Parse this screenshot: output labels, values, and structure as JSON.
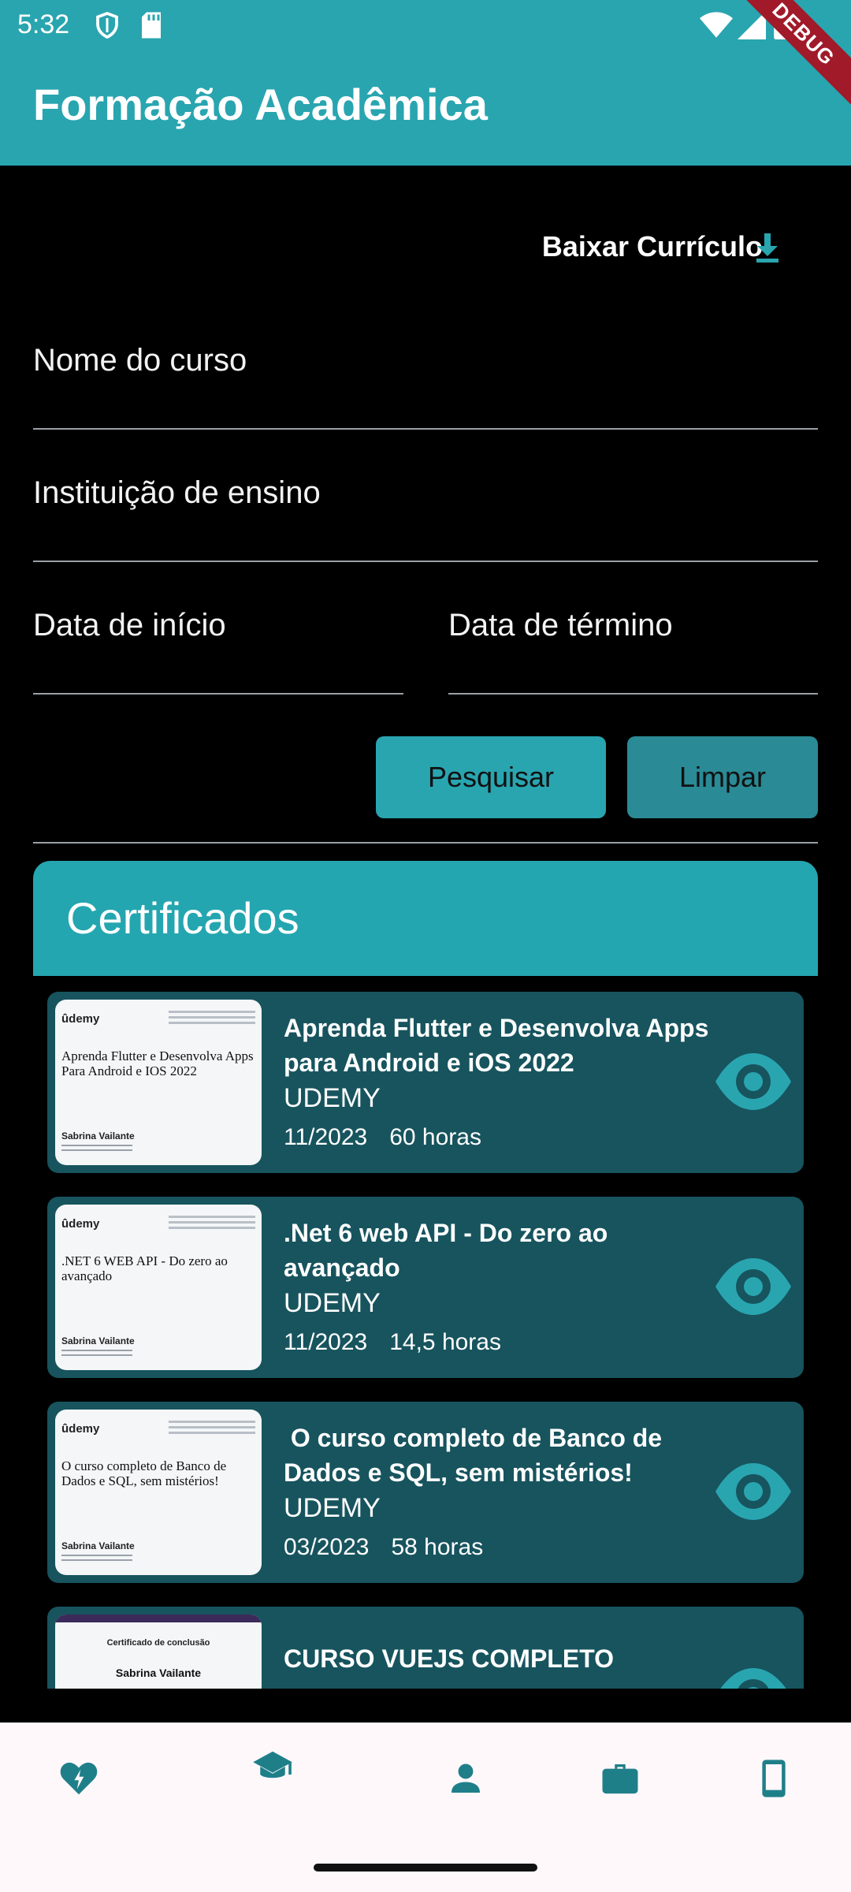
{
  "status_bar": {
    "time": "5:32"
  },
  "debug_banner": "DEBUG",
  "app_bar": {
    "title": "Formação Acadêmica"
  },
  "download": {
    "label": "Baixar Currículo"
  },
  "form": {
    "course_name_placeholder": "Nome do curso",
    "institution_placeholder": "Instituição de ensino",
    "start_date_placeholder": "Data de início",
    "end_date_placeholder": "Data de término",
    "search_button": "Pesquisar",
    "clear_button": "Limpar"
  },
  "certificates": {
    "header": "Certificados",
    "items": [
      {
        "title": "Aprenda Flutter e Desenvolva Apps para Android e iOS 2022",
        "institution": "UDEMY",
        "date": "11/2023",
        "hours": "60 horas",
        "thumb_brand": "ûdemy",
        "thumb_title": "Aprenda Flutter e Desenvolva Apps Para Android e IOS 2022",
        "thumb_name": "Sabrina Vailante"
      },
      {
        "title": ".Net 6 web API - Do zero ao avançado",
        "institution": "UDEMY",
        "date": "11/2023",
        "hours": "14,5 horas",
        "thumb_brand": "ûdemy",
        "thumb_title": ".NET 6 WEB API - Do zero ao avançado",
        "thumb_name": "Sabrina Vailante"
      },
      {
        "title": " O curso completo de Banco de Dados e SQL, sem mistérios!",
        "institution": "UDEMY",
        "date": "03/2023",
        "hours": "58 horas",
        "thumb_brand": "ûdemy",
        "thumb_title": "O curso completo de Banco de Dados e SQL, sem mistérios!",
        "thumb_name": "Sabrina Vailante"
      },
      {
        "title": "CURSO VUEJS COMPLETO",
        "thumb_caption": "Certificado de conclusão",
        "thumb_name": "Sabrina Vailante"
      }
    ]
  },
  "bottom_nav": {
    "items": [
      {
        "icon": "heart-bolt-icon"
      },
      {
        "icon": "graduation-cap-icon",
        "active": true
      },
      {
        "icon": "person-icon"
      },
      {
        "icon": "briefcase-icon"
      },
      {
        "icon": "smartphone-icon"
      }
    ]
  },
  "colors": {
    "accent": "#29a5b0",
    "card": "#17545e",
    "nav_bg": "#fff8fb"
  }
}
